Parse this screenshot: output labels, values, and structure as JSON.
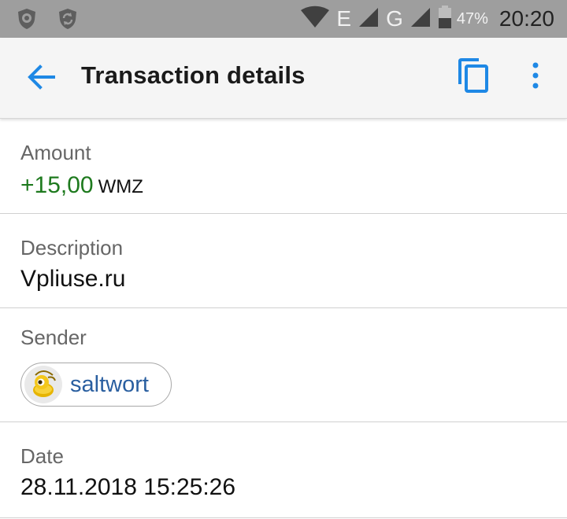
{
  "status_bar": {
    "network_letter_1": "E",
    "network_letter_2": "G",
    "battery_percent": "47%",
    "time": "20:20",
    "icons": [
      "shield-lion-icon",
      "sync-icon",
      "wifi-icon",
      "signal-icon",
      "signal-icon",
      "battery-icon"
    ]
  },
  "app_bar": {
    "title": "Transaction details",
    "icons": [
      "back-arrow-icon",
      "copy-icon",
      "more-vert-icon"
    ],
    "accent": "#1e88e5"
  },
  "fields": {
    "amount": {
      "label": "Amount",
      "value": "+15,00",
      "currency": "WMZ",
      "value_color": "#1e7a1e"
    },
    "description": {
      "label": "Description",
      "value": "Vpliuse.ru"
    },
    "sender": {
      "label": "Sender",
      "name": "saltwort",
      "avatar_icon": "webmoney-bee-icon"
    },
    "date": {
      "label": "Date",
      "value": "28.11.2018 15:25:26"
    }
  }
}
